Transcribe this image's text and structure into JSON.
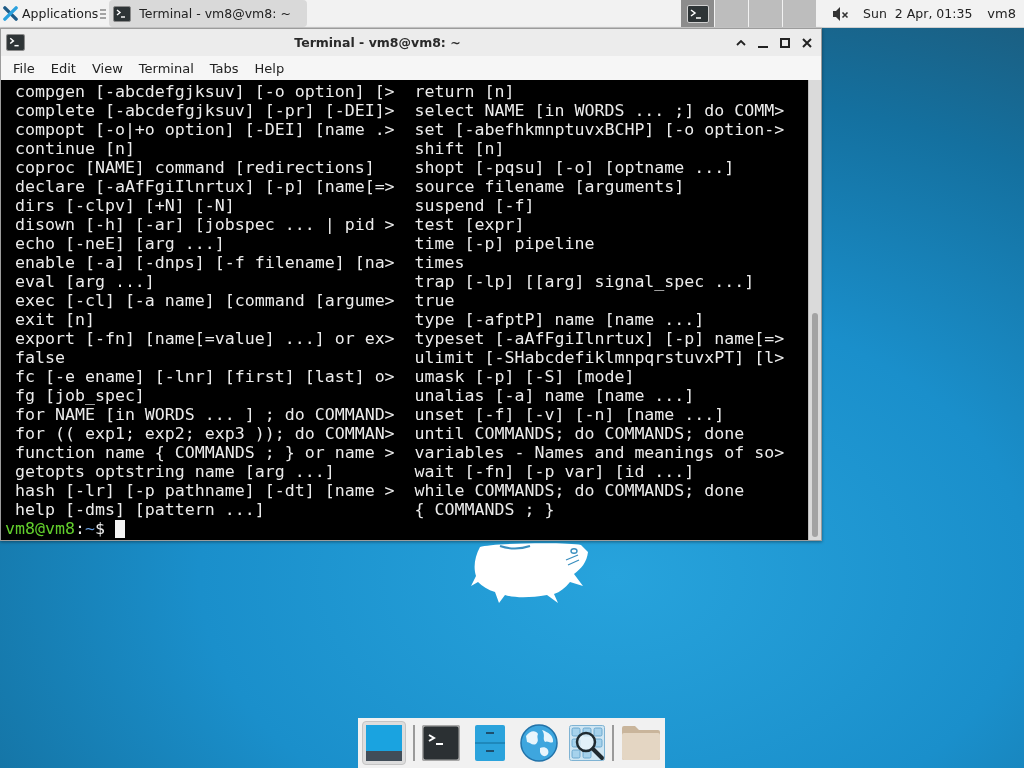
{
  "top_panel": {
    "applications_menu": {
      "label": "Applications"
    },
    "tasks": [
      {
        "label": "Terminal - vm8@vm8: ~",
        "selected": true
      }
    ],
    "workspaces": [
      {
        "selected": true
      },
      {
        "selected": false
      },
      {
        "selected": false
      },
      {
        "selected": false
      }
    ],
    "volume": {
      "muted": true
    },
    "clock": "Sun  2 Apr, 01:35",
    "user": "vm8"
  },
  "window": {
    "title": "Terminal - vm8@vm8: ~",
    "menu": [
      "File",
      "Edit",
      "View",
      "Terminal",
      "Tabs",
      "Help"
    ],
    "terminal": {
      "rows": [
        {
          "left": "compgen [-abcdefgjksuv] [-o option] [>",
          "right": "return [n]"
        },
        {
          "left": "complete [-abcdefgjksuv] [-pr] [-DEI]>",
          "right": "select NAME [in WORDS ... ;] do COMM>"
        },
        {
          "left": "compopt [-o|+o option] [-DEI] [name .>",
          "right": "set [-abefhkmnptuvxBCHP] [-o option->"
        },
        {
          "left": "continue [n]",
          "right": "shift [n]"
        },
        {
          "left": "coproc [NAME] command [redirections]",
          "right": "shopt [-pqsu] [-o] [optname ...]"
        },
        {
          "left": "declare [-aAfFgiIlnrtux] [-p] [name[=>",
          "right": "source filename [arguments]"
        },
        {
          "left": "dirs [-clpv] [+N] [-N]",
          "right": "suspend [-f]"
        },
        {
          "left": "disown [-h] [-ar] [jobspec ... | pid >",
          "right": "test [expr]"
        },
        {
          "left": "echo [-neE] [arg ...]",
          "right": "time [-p] pipeline"
        },
        {
          "left": "enable [-a] [-dnps] [-f filename] [na>",
          "right": "times"
        },
        {
          "left": "eval [arg ...]",
          "right": "trap [-lp] [[arg] signal_spec ...]"
        },
        {
          "left": "exec [-cl] [-a name] [command [argume>",
          "right": "true"
        },
        {
          "left": "exit [n]",
          "right": "type [-afptP] name [name ...]"
        },
        {
          "left": "export [-fn] [name[=value] ...] or ex>",
          "right": "typeset [-aAfFgiIlnrtux] [-p] name[=>"
        },
        {
          "left": "false",
          "right": "ulimit [-SHabcdefiklmnpqrstuvxPT] [l>"
        },
        {
          "left": "fc [-e ename] [-lnr] [first] [last] o>",
          "right": "umask [-p] [-S] [mode]"
        },
        {
          "left": "fg [job_spec]",
          "right": "unalias [-a] name [name ...]"
        },
        {
          "left": "for NAME [in WORDS ... ] ; do COMMAND>",
          "right": "unset [-f] [-v] [-n] [name ...]"
        },
        {
          "left": "for (( exp1; exp2; exp3 )); do COMMAN>",
          "right": "until COMMANDS; do COMMANDS; done"
        },
        {
          "left": "function name { COMMANDS ; } or name >",
          "right": "variables - Names and meanings of so>"
        },
        {
          "left": "getopts optstring name [arg ...]",
          "right": "wait [-fn] [-p var] [id ...]"
        },
        {
          "left": "hash [-lr] [-p pathname] [-dt] [name >",
          "right": "while COMMANDS; do COMMANDS; done"
        },
        {
          "left": "help [-dms] [pattern ...]",
          "right": "{ COMMANDS ; }"
        }
      ],
      "prompt": {
        "user_host": "vm8@vm8",
        "separator": ":",
        "path": "~",
        "symbol": "$"
      }
    }
  }
}
